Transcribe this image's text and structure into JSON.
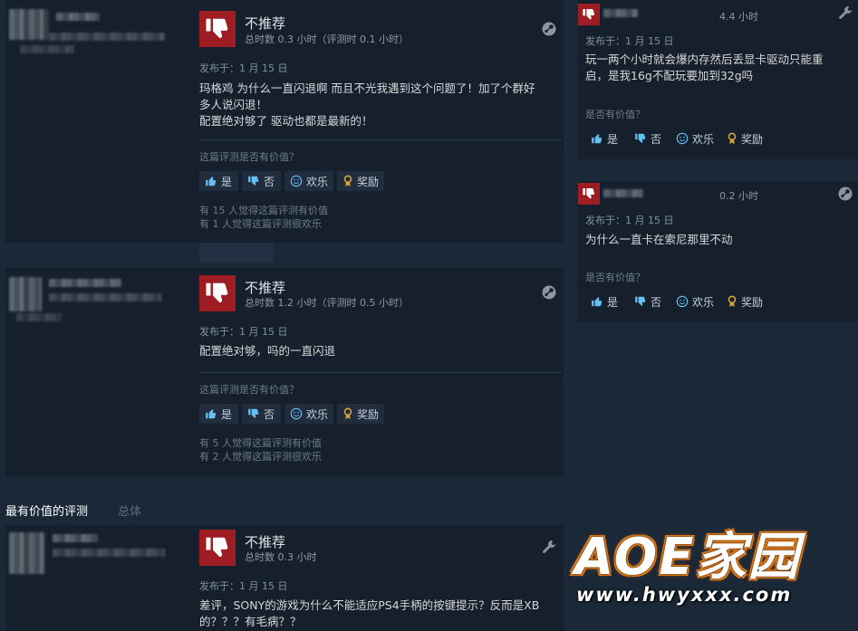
{
  "reviews_main": [
    {
      "verdict": "不推荐",
      "hours": "总时数 0.3 小时（评测时 0.1 小时）",
      "posted": "发布于：1 月 15 日",
      "content_lines": [
        "玛格鸡 为什么一直闪退啊 而且不光我遇到这个问题了！加了个群好",
        "多人说闪退！",
        "配置绝对够了 驱动也都是最新的！"
      ],
      "helpful_question": "这篇评测是否有价值？",
      "buttons": {
        "yes": "是",
        "no": "否",
        "funny": "欢乐",
        "award": "奖励"
      },
      "stats": [
        "有 15 人觉得这篇评测有价值",
        "有 1 人觉得这篇评测很欢乐"
      ]
    },
    {
      "verdict": "不推荐",
      "hours": "总时数 1.2 小时（评测时 0.5 小时）",
      "posted": "发布于：1 月 15 日",
      "content_lines": [
        "配置绝对够，吗的一直闪退"
      ],
      "helpful_question": "这篇评测是否有价值？",
      "buttons": {
        "yes": "是",
        "no": "否",
        "funny": "欢乐",
        "award": "奖励"
      },
      "stats": [
        "有 5 人觉得这篇评测有价值",
        "有 2 人觉得这篇评测很欢乐"
      ]
    },
    {
      "verdict": "不推荐",
      "hours": "总时数 0.3 小时",
      "posted": "发布于：1 月 15 日",
      "content_lines": [
        "差评，SONY的游戏为什么不能适应PS4手柄的按键提示？反而是XB",
        "的？？？有毛病？？"
      ]
    }
  ],
  "reviews_side": [
    {
      "hours": "4.4 小时",
      "posted": "发布于：1 月 15 日",
      "content_lines": [
        "玩一两个小时就会爆内存然后丢显卡驱动只能重",
        "启，是我16g不配玩要加到32g吗"
      ],
      "helpful_question": "是否有价值？",
      "buttons": {
        "yes": "是",
        "no": "否",
        "funny": "欢乐",
        "award": "奖励"
      }
    },
    {
      "hours": "0.2 小时",
      "posted": "发布于：1 月 15 日",
      "content_lines": [
        "为什么一直卡在索尼那里不动"
      ],
      "helpful_question": "是否有价值？",
      "buttons": {
        "yes": "是",
        "no": "否",
        "funny": "欢乐",
        "award": "奖励"
      }
    }
  ],
  "section": {
    "title": "最有价值的评测",
    "subtitle": "总体"
  },
  "watermark": {
    "title": "AOE家园",
    "url": "www.hwyxxx.com"
  },
  "colors": {
    "background": "#1b2838",
    "card": "#16202d",
    "thumb_down": "#9e1d22",
    "link_blue": "#66c0f4",
    "award_gold": "#d4a33a"
  },
  "icons": [
    "thumbs-down-icon",
    "steam-icon",
    "thumbs-up-icon",
    "smile-icon",
    "award-icon",
    "wrench-icon"
  ]
}
